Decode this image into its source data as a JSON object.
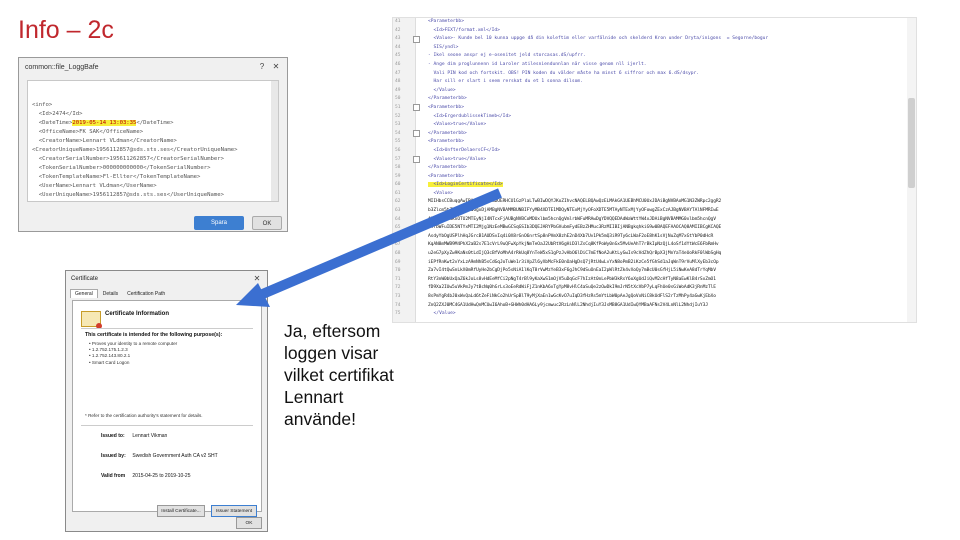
{
  "slide": {
    "title": "Info – 2c"
  },
  "log_dialog": {
    "title": "common::file_LoggBafe",
    "help_icon": "help-icon",
    "close_icon": "close-icon",
    "lines": [
      {
        "pre": "<info>",
        "hl": "",
        "post": ""
      },
      {
        "pre": "  <Id>2474</Id>",
        "hl": "",
        "post": ""
      },
      {
        "pre": "  <DateTime>",
        "hl": "2019-05-14 13:03:35",
        "post": "</DateTime>"
      },
      {
        "pre": "  <OfficeName>FK SAK</OfficeName>",
        "hl": "",
        "post": ""
      },
      {
        "pre": "  <CreatorName>Lennart VLdman</CreatorName>",
        "hl": "",
        "post": ""
      },
      {
        "pre": "",
        "hl": "",
        "post": ""
      },
      {
        "pre": "<CreatorUniqueName>1956112857@sds.sts.ses</CreatorUniqueName>",
        "hl": "",
        "post": ""
      },
      {
        "pre": "  <CreatorSerialNumber>195611262857</CreatorSerialNumber>",
        "hl": "",
        "post": ""
      },
      {
        "pre": "  <TokenSerialNumber>000000000000</TokenSerialNumber>",
        "hl": "",
        "post": ""
      },
      {
        "pre": "  <TokenTemplateName>Fl-Ellter</TokenTemplateName>",
        "hl": "",
        "post": ""
      },
      {
        "pre": "  <UserName>Lennart VLdman</UserName>",
        "hl": "",
        "post": ""
      },
      {
        "pre": "  <UserUniqueName>1956112857@sds.sts.ses</UserUniqueName>",
        "hl": "",
        "post": ""
      },
      {
        "pre": "  <UserSerialNumber>195611262857</UserSerialNumber>",
        "hl": "",
        "post": ""
      }
    ],
    "save_label": "Spara",
    "ok_label": "OK"
  },
  "xml_panel": {
    "line_numbers": [
      "41",
      "42",
      "43",
      "44",
      "45",
      "46",
      "47",
      "48",
      "49",
      "50",
      "51",
      "52",
      "53",
      "54",
      "55",
      "56",
      "57",
      "58",
      "59",
      "60",
      "61",
      "62",
      "63",
      "64",
      "65",
      "66",
      "67",
      "68",
      "69",
      "70",
      "71",
      "72",
      "73",
      "74",
      "75"
    ],
    "lines": [
      {
        "cls": "",
        "text": "<Parameterbb>"
      },
      {
        "cls": "",
        "text": "  <Id>FEXT/format.xml</Id>"
      },
      {
        "cls": "",
        "text": "  <Value>- Kunde bel 10 kunna uppge då din koleftim eller varfälnide och skelderd Kron under Dryta/inigons  = Segorne/bogur"
      },
      {
        "cls": "",
        "text": "  SIS/yndl>"
      },
      {
        "cls": "",
        "text": "- Ikel seone anspr ej e-osenitet jeld storcasas.dS/upfrr."
      },
      {
        "cls": "",
        "text": "- Ange dim proglunnenn id Laroler atilesniendunnlan när visse genom nll ijerlt."
      },
      {
        "cls": "",
        "text": "  Vali PIN kod och fortskit. OBS! PIN koden du välder måste ha minst 6 siffror och max 6.dS/dsypr."
      },
      {
        "cls": "",
        "text": "  Har sill er slart i seem rerskat du et 1 sonna dilsom."
      },
      {
        "cls": "",
        "text": "  </Value>"
      },
      {
        "cls": "",
        "text": "</Parameterbb>"
      },
      {
        "cls": "",
        "text": "<Parameterbb>"
      },
      {
        "cls": "",
        "text": "  <Id>ErgerdublissekTimeb</Id>"
      },
      {
        "cls": "",
        "text": "  <Value>true</Value>"
      },
      {
        "cls": "",
        "text": "</Parameterbb>"
      },
      {
        "cls": "",
        "text": "<Parameterbb>"
      },
      {
        "cls": "",
        "text": "  <Id>UnfterDelaersCF</Id>"
      },
      {
        "cls": "",
        "text": "  <Value>true</Value>"
      },
      {
        "cls": "",
        "text": "</Parameterbb>"
      },
      {
        "cls": "",
        "text": "<Parameterbb>"
      },
      {
        "cls": "hl",
        "text": "  <Id>LoginCertificate</Id>"
      },
      {
        "cls": "",
        "text": "  <Value>"
      },
      {
        "cls": "b64",
        "text": "MIIHbsCCBuqgAwIBAgIRAMWHuDOERHCU1GzPlaLTwBIwDQYJKoZIhvcNAQELBQAwQzELMAkGA1UEBhMCU0UxJDAiBgNVBAoMG1N3ZWRpc2ggR2"
      },
      {
        "cls": "b64",
        "text": "b3Zlcm5tZW50IEF1dGgxDjAMBgNVBAMMBUNBIFYyMB4XDTE1MDQyNTExMjYyOFoXDTE5MTAyNTExMjYyOFowgZExCzAJBgNVBAYTAlNFMRIwE"
      },
      {
        "cls": "b64",
        "text": "AYDVQQFEwkxOTU2MTEyNjI4NTcxFjAUBgNVBCoMDUxlbm5hcnQgVmlrbWFuMRAwDgYDVQQEDAdWaWttYW4xJDAiBgNVBAMMG0xlbm5hcnQgV"
      },
      {
        "cls": "b64",
        "text": "mlrbWFuIDE5NTYxMTI2Mjg1NzEeMBwGCSqGSIb3DQEJARYPbGVubmFydEBzZHMuc3RzMIIBIjANBgkqhkiG9w0BAQEFAAOCAQ8AMIIBCgKCAQE"
      },
      {
        "cls": "b64",
        "text": "AsdyYbOgUSPlhHqJGrcB1AUDSvIq4i0X8rGnO6nrtSp8nPVmX8zhE2nD4Xb7Uv1Pk5mQ3iR9Ty6cLWaF2oE8hK1sVjNuZqM7xGtYbP0dHcR"
      },
      {
        "cls": "b64",
        "text": "KqAN8mMWB9M4PhX2aB2s7E1cVrL9uQFwXpYkjNmTeOaJ2UbRtV6gHiD3lZsCq8KfPoWy0nGx5MvUeAhT7rBkIpNzQjL4oSf1dYtWcE6FbRmHv"
      },
      {
        "cls": "b64",
        "text": "u2eG7pXyZw9KaNs0tLdIjQ3cBfVoMhA4rRkUq8YnTeW5xS1gPzJvHbO6lDiC7mEfNoA2uKtLyGwIs9cVdZhQrBpX3jMnYaT4eUoRkF0lWbSgHq"
      },
      {
        "cls": "b64",
        "text": "iEPfRnKwt2vYxLzA9mNhB5sCdGqJoTuWe1r3iVpZl6yXbMcFkE0nOaHgDsQ7jRtU4wLvYxN8oPmB2iKzCe5fGhSd1aJqWnT9rVuMlXyEb3cOp"
      },
      {
        "cls": "b64",
        "text": "Za7vI4tQwSnLkX0mRfUyHe2bCgDjPo5sNiA1lKqT8rVwMzYeB3xF6gJhC9dSuOnEaI2pWlRtZk4vXoQy7mBcU0sGfHjL5iNwKeA8dTrYqMbV"
      },
      {
        "cls": "b64",
        "text": "RtY3nW0bUxQaZ6kJoLs8vHdEeMfCi2pNgT4rBl9yKaXwS1mOjV5uDqGcF7hIzAt0nLePbW3kRsY6oXgUdJiQvM2cHfTyN8aEwKlB4rSxZmO1"
      },
      {
        "cls": "b64",
        "text": "fD9Xa2IUw5uVkPmJy7tBcNq0hGrLs3oEeRdWiFjZ1nKbA6xTgYpM8vHlC4aSuQe2zOwDkI9mJrN5tXcVbP7yLqFhUe0sGiWoAdK3jRnMzTlE"
      },
      {
        "cls": "b64",
        "text": "8sPmYgR4bJ0xWvQaLd6tZeFiNkCo2hUrSpBlT9yMjXaEn1wGcKvO7uIqD3fHzRs5mYtLbW0pAeJgQoVxNiC8kUdFlS2rTzMhPy4aGwKjEbXo"
      },
      {
        "cls": "b64",
        "text": "ZnQ2ZXJ0MC4GA1UdHwQnMCUwI6AhoB+GHWh0dHA6Ly9jcmwuc2RzLnNlL2NhdjIuY3JsMB8GA1UdIwQYMBaAFNs2V4LnNlL2NhdjIuY3J"
      },
      {
        "cls": "",
        "text": "  </Value>"
      }
    ]
  },
  "cert_dialog": {
    "title": "Certificate",
    "close_icon": "close-icon",
    "tabs": [
      "General",
      "Details",
      "Certification Path"
    ],
    "heading": "Certificate Information",
    "purpose_title": "This certificate is intended for the following purpose(s):",
    "purposes": [
      "• Proves your identity to a remote computer",
      "• 1.2.752.175.1.2.3",
      "• 1.2.752.143.80.2.1",
      "• Smart Card Logon"
    ],
    "note": "* Refer to the certification authority's statement for details.",
    "issued_to_label": "Issued to:",
    "issued_to_value": "Lennart Vikman",
    "issued_by_label": "Issued by:",
    "issued_by_value": "Swedish Government Auth CA v2 SHT",
    "valid_from_label": "Valid from",
    "valid_from_value": "2015-04-25 to 2019-10-25",
    "install_label": "Install Certificate...",
    "issuer_label": "Issuer Statement",
    "ok_label": "OK"
  },
  "caption": {
    "lines": [
      "Ja, eftersom",
      "loggen visar",
      "vilket certifikat",
      "Lennart",
      "använde!"
    ]
  },
  "colors": {
    "title": "#c0272d",
    "arrow": "#3b6fd1",
    "highlight": "#f7ef3a"
  }
}
